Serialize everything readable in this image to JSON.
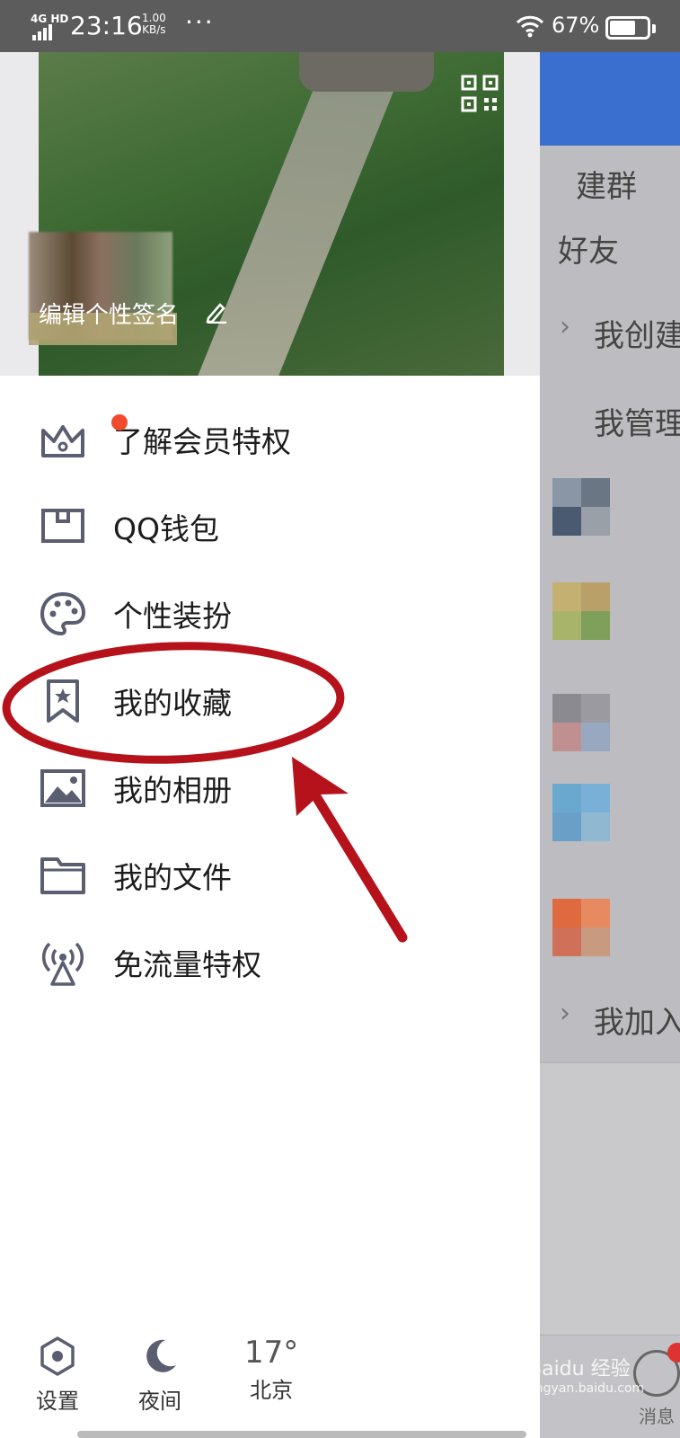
{
  "status_bar": {
    "network": "4G HD",
    "time": "23:16",
    "speed_value": "1.00",
    "speed_unit": "KB/s",
    "more": "···",
    "battery_pct": "67%"
  },
  "header": {
    "signature": "编辑个性签名"
  },
  "menu": {
    "items": [
      {
        "label": "了解会员特权",
        "icon": "crown-icon"
      },
      {
        "label": "QQ钱包",
        "icon": "wallet-icon"
      },
      {
        "label": "个性装扮",
        "icon": "palette-icon"
      },
      {
        "label": "我的收藏",
        "icon": "bookmark-star-icon"
      },
      {
        "label": "我的相册",
        "icon": "album-icon"
      },
      {
        "label": "我的文件",
        "icon": "folder-icon"
      },
      {
        "label": "免流量特权",
        "icon": "broadcast-icon"
      }
    ]
  },
  "bottom": {
    "settings_label": "设置",
    "night_label": "夜间",
    "temperature": "17°",
    "city": "北京"
  },
  "background_app": {
    "row_texts": [
      "建群",
      "好友",
      "我创建",
      "我管理",
      "我加入"
    ],
    "tab_label": "消息"
  },
  "watermark": {
    "brand": "Baidu 经验",
    "url": "jingyan.baidu.com"
  },
  "colors": {
    "accent_red": "#f04b2d",
    "annotation_red": "#b5121b",
    "icon_gray": "#5a5e70"
  }
}
